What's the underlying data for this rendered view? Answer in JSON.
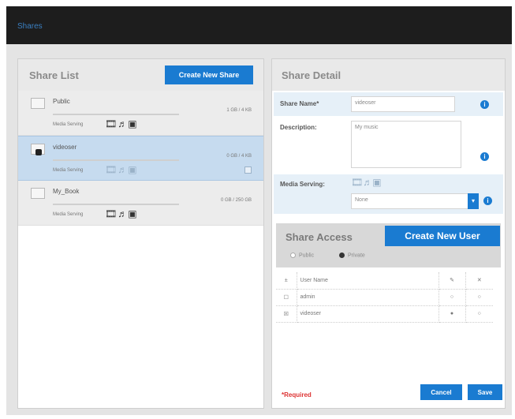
{
  "topbar": {
    "brand": "Shares"
  },
  "list": {
    "title": "Share List",
    "create_label": "Create New Share",
    "shares": [
      {
        "name": "Public",
        "size": "1 GB / 4 KB",
        "media_label": "Media Serving",
        "media_icons": "🎞♬▣",
        "selected": false
      },
      {
        "name": "videoser",
        "size": "0 GB / 4 KB",
        "media_label": "Media Serving",
        "media_icons": "🎞♬▣",
        "selected": true
      },
      {
        "name": "My_Book",
        "size": "0 GB / 250 GB",
        "media_label": "Media Serving",
        "media_icons": "🎞♬▣",
        "selected": false
      }
    ]
  },
  "detail": {
    "title": "Share Detail",
    "share_name_label": "Share Name*",
    "share_name_value": "videoser",
    "description_label": "Description:",
    "description_value": "My music",
    "media_label": "Media Serving:",
    "media_icons": "🎞♬▣",
    "media_select": "None",
    "access": {
      "title": "Share Access",
      "create_user_label": "Create New User",
      "public_label": "Public",
      "private_label": "Private",
      "columns": [
        "",
        "User Name"
      ],
      "users": [
        {
          "name": "admin",
          "checked": false
        },
        {
          "name": "videoser",
          "checked": true
        }
      ]
    },
    "required_label": "*Required",
    "cancel_label": "Cancel",
    "save_label": "Save"
  }
}
